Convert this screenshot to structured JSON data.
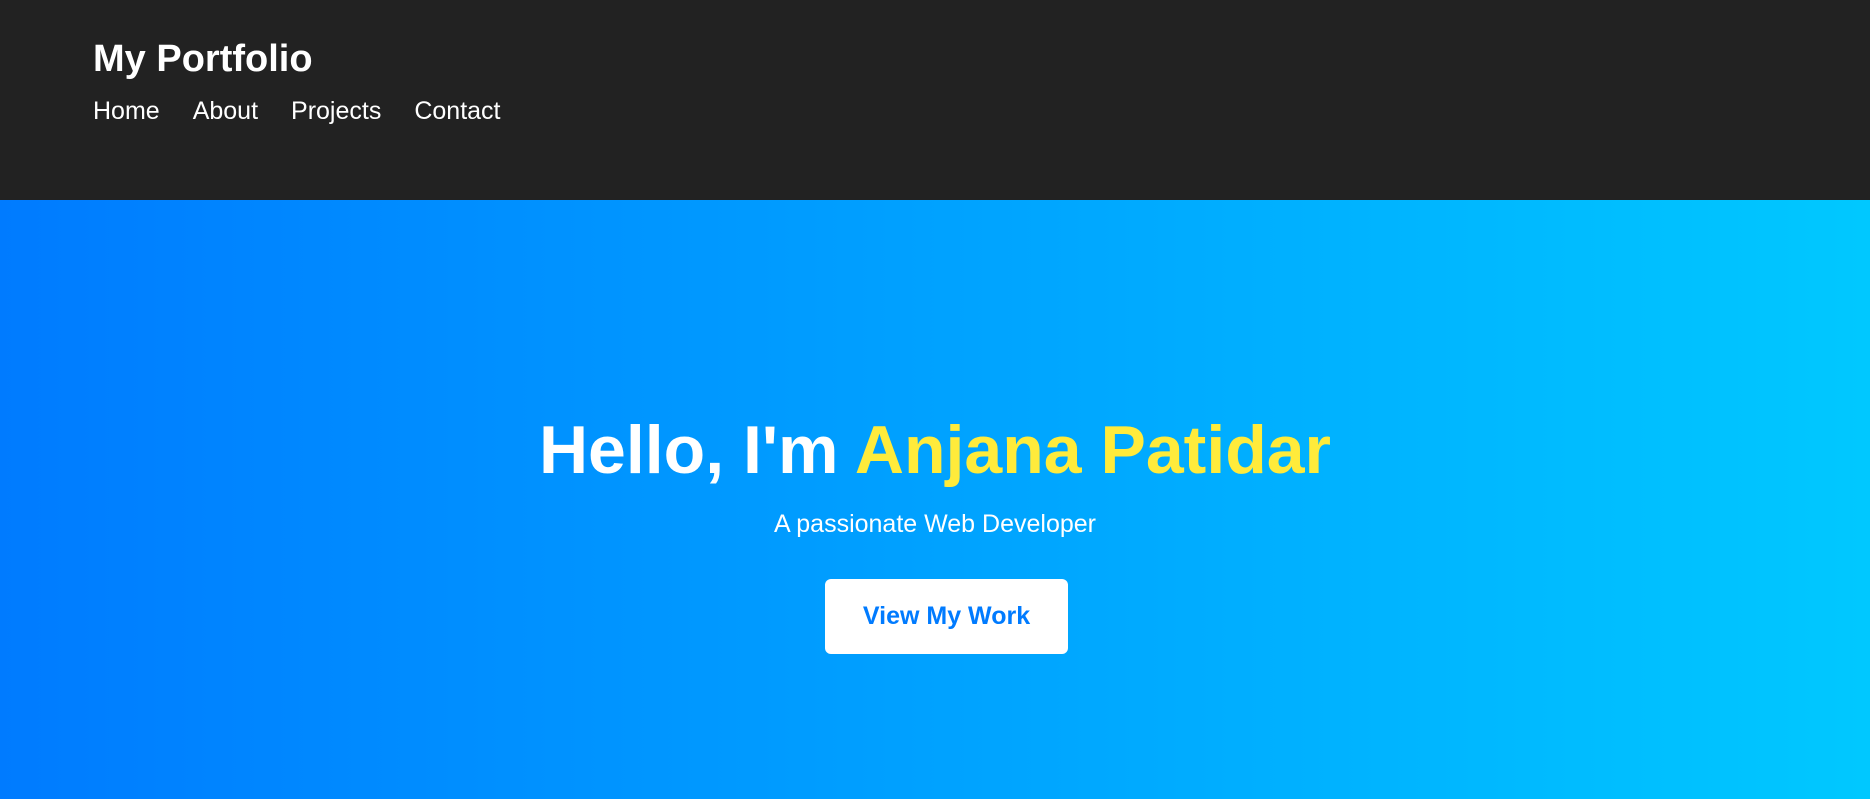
{
  "header": {
    "brand": "My Portfolio",
    "nav": [
      {
        "label": "Home"
      },
      {
        "label": "About"
      },
      {
        "label": "Projects"
      },
      {
        "label": "Contact"
      }
    ]
  },
  "hero": {
    "greeting": "Hello, I'm ",
    "name": "Anjana Patidar",
    "subtitle": "A passionate Web Developer",
    "button_label": "View My Work"
  },
  "colors": {
    "header_background": "#222222",
    "hero_gradient_start": "#007bff",
    "hero_gradient_end": "#00c8ff",
    "name_highlight": "#ffeb3b",
    "button_text": "#007bff"
  }
}
